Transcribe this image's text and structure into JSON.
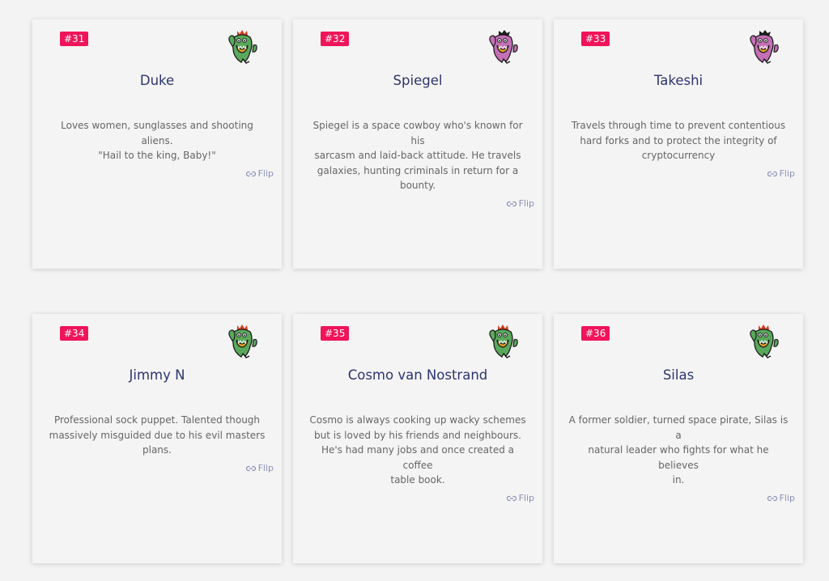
{
  "colors": {
    "background": "#f3f3f3",
    "card": "#f4f4f4",
    "badge": "#f0145a",
    "name": "#2c3570",
    "flip": "#8a90b8"
  },
  "cards": [
    {
      "badge": "#31",
      "name": "Duke",
      "desc_lines": [
        "Loves women, sunglasses and shooting aliens.",
        "\"Hail to the king, Baby!\""
      ],
      "flip_label": "Flip",
      "avatar_icon": "green-monster-icon"
    },
    {
      "badge": "#32",
      "name": "Spiegel",
      "desc_lines": [
        "Spiegel is a space cowboy who's known for his",
        "sarcasm and laid-back attitude. He travels",
        "galaxies, hunting criminals in return for a",
        "bounty."
      ],
      "flip_label": "Flip",
      "avatar_icon": "purple-monster-icon"
    },
    {
      "badge": "#33",
      "name": "Takeshi",
      "desc_lines": [
        "Travels through time to prevent contentious",
        "hard forks and to protect the integrity of",
        "cryptocurrency"
      ],
      "flip_label": "Flip",
      "avatar_icon": "purple-monster-icon"
    },
    {
      "badge": "#34",
      "name": "Jimmy N",
      "desc_lines": [
        "Professional sock puppet. Talented though",
        "massively misguided due to his evil masters",
        "plans."
      ],
      "flip_label": "Flip",
      "avatar_icon": "green-monster-icon"
    },
    {
      "badge": "#35",
      "name": "Cosmo van Nostrand",
      "desc_lines": [
        "Cosmo is always cooking up wacky schemes",
        "but is loved by his friends and neighbours.",
        "He's had many jobs and once created a coffee",
        "table book."
      ],
      "flip_label": "Flip",
      "avatar_icon": "green-monster-icon"
    },
    {
      "badge": "#36",
      "name": "Silas",
      "desc_lines": [
        "A former soldier, turned space pirate, Silas is a",
        "natural leader who fights for what he believes",
        "in."
      ],
      "flip_label": "Flip",
      "avatar_icon": "green-monster-icon"
    }
  ]
}
